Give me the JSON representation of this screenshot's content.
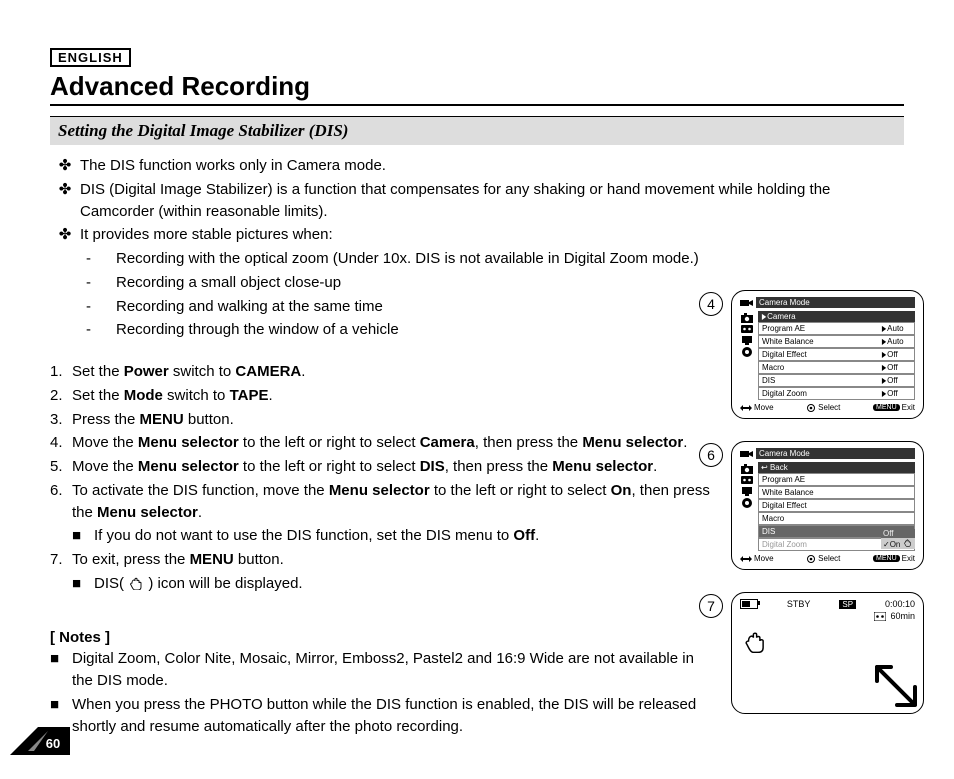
{
  "language_label": "ENGLISH",
  "page_title": "Advanced Recording",
  "section_heading": "Setting the Digital Image Stabilizer (DIS)",
  "intro_bullets": [
    "The DIS function works only in Camera mode.",
    "DIS (Digital Image Stabilizer) is a function that compensates for any shaking or hand movement while holding the Camcorder (within reasonable limits).",
    "It provides more stable pictures when:"
  ],
  "intro_subitems": [
    "Recording with the optical zoom (Under 10x. DIS is not available in Digital Zoom mode.)",
    "Recording a small object close-up",
    "Recording and walking at the same time",
    "Recording through the window of a vehicle"
  ],
  "steps": {
    "s1_a": "Set the ",
    "s1_b": "Power",
    "s1_c": " switch to ",
    "s1_d": "CAMERA",
    "s1_e": ".",
    "s2_a": "Set the ",
    "s2_b": "Mode",
    "s2_c": " switch to ",
    "s2_d": "TAPE",
    "s2_e": ".",
    "s3_a": "Press the ",
    "s3_b": "MENU",
    "s3_c": " button.",
    "s4_a": "Move the ",
    "s4_b": "Menu selector",
    "s4_c": " to the left or right to select ",
    "s4_d": "Camera",
    "s4_e": ", then press the ",
    "s4_f": "Menu selector",
    "s4_g": ".",
    "s5_a": "Move the ",
    "s5_b": "Menu selector",
    "s5_c": " to the left or right to select ",
    "s5_d": "DIS",
    "s5_e": ", then press the ",
    "s5_f": "Menu selector",
    "s5_g": ".",
    "s6_a": "To activate the DIS function, move the ",
    "s6_b": "Menu selector",
    "s6_c": " to the left or right to select ",
    "s6_d": "On",
    "s6_e": ", then press the ",
    "s6_f": "Menu selector",
    "s6_g": ".",
    "s6_note_a": "If you do not want to use the DIS function, set the DIS menu to ",
    "s6_note_b": "Off",
    "s6_note_c": ".",
    "s7_a": "To exit, press the ",
    "s7_b": "MENU",
    "s7_c": " button.",
    "s7_note_a": "DIS( ",
    "s7_note_b": " ) icon will be displayed."
  },
  "notes_heading": "[ Notes ]",
  "notes": [
    "Digital Zoom, Color Nite, Mosaic, Mirror, Emboss2, Pastel2 and 16:9 Wide are not available in the DIS mode.",
    "When you press the PHOTO button while the DIS function is enabled, the DIS will be released shortly and resume automatically after the photo recording."
  ],
  "page_number": "60",
  "figures": {
    "fig4_num": "4",
    "fig6_num": "6",
    "fig7_num": "7",
    "menu_title": "Camera Mode",
    "back_label": "Back",
    "camera_label": "Camera",
    "items": {
      "program_ae": "Program AE",
      "white_balance": "White Balance",
      "digital_effect": "Digital Effect",
      "macro": "Macro",
      "dis": "DIS",
      "digital_zoom": "Digital Zoom"
    },
    "values": {
      "auto": "Auto",
      "off": "Off",
      "on": "On"
    },
    "nav": {
      "move": "Move",
      "select": "Select",
      "menu": "MENU",
      "exit": "Exit"
    },
    "status": {
      "stby": "STBY",
      "sp": "SP",
      "time": "0:00:10",
      "remain": "60min"
    }
  }
}
